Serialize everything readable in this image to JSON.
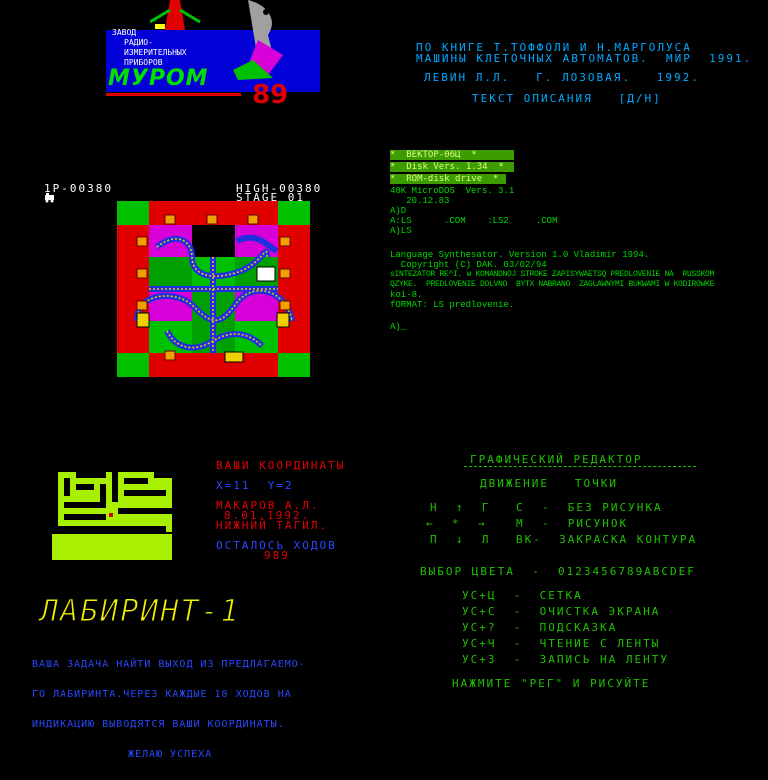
{
  "colors": {
    "red": "#e00000",
    "magenta": "#d800d8",
    "green": "#00c000",
    "yellow": "#e0e000",
    "cyan": "#00d8d8",
    "blue": "#2848ff",
    "lime": "#a8f000"
  },
  "panel1": {
    "company_lines": [
      "ЗАВОД",
      "РАДИО-",
      "ИЗМЕРИТЕЛЬНЫХ",
      "ПРИБОРОВ"
    ],
    "brand": "МУРОМ",
    "year": "89"
  },
  "panel2": {
    "lines": [
      "ПО КНИГЕ Т.ТОФФОЛИ И Н.МАРГОЛУСА",
      "МАШИНЫ КЛЕТОЧНЫХ АВТОМАТОВ.  МИР  1991.",
      "ЛЕВИН Л.Л.   Г. ЛОЗОВАЯ.   1992.",
      "ТЕКСТ ОПИСАНИЯ   [Д/Н]"
    ]
  },
  "panel3": {
    "score": "1P-00380",
    "high": "HIGH-00380",
    "stage": "STAGE 01",
    "lives_icon": "locomotive-icon"
  },
  "panel4": {
    "header_lines": [
      "*  ВЕКТОР-06Ц  *",
      "*  Disk Vers. 1.34  *",
      "*  ROM-disk drive  *"
    ],
    "body_lines": [
      "48K MicroDOS  Vers. 3.1",
      "   20.12.83",
      "A)D",
      "A:LS      .COM    :LS2     .COM",
      "A)LS",
      "",
      "Language Synthesator. Version 1.0 Vladimir 1994.",
      "  Copyright (C) DAK. 03/02/94",
      "sINTEZATOR RE^I. w KOMANDNOJ STROKE ZAPISYWAETSQ PREDLOVENIE NA  RUSSKOM",
      "QZYKE.  PREDLOVENIE DOLVNO  BYTX NABRANO  ZAGLAWNYMI BUKWAMI W KODIROWKE",
      "koi-8.",
      "fORMAT: LS predlovenie.",
      "",
      "A)_"
    ]
  },
  "panel5": {
    "coords_title": "ВАШИ КООРДИНАТЫ",
    "coords": "X=11  Y=2",
    "author": "МАКАРОВ А.Л.",
    "date": "8.01.1992.",
    "city": "НИЖНИЙ ТАГИЛ.",
    "moves_label": "ОСТАЛОСЬ ХОДОВ",
    "moves_value": "989",
    "title": "ЛАБИРИНТ-1",
    "desc_lines": [
      "ВАША ЗАДАЧА НАЙТИ ВЫХОД ИЗ ПРЕДЛАГАЕМО-",
      "ГО ЛАБИРИНТА.ЧЕРЕЗ КАЖДЫЕ 10 ХОДОВ НА",
      "ИНДИКАЦИЮ ВЫВОДЯТСЯ ВАШИ КООРДИНАТЫ.",
      "ЖЕЛАЮ УСПЕХА"
    ]
  },
  "panel6": {
    "title": "ГРАФИЧЕСКИЙ РЕДАКТОР",
    "move_label": "ДВИЖЕНИЕ   ТОЧКИ",
    "keys": [
      {
        "k": "Н  ↑  Г",
        "d": "С  -  БЕЗ РИСУНКА"
      },
      {
        "k": "←  *  →",
        "d": "М  -  РИСУНОК"
      },
      {
        "k": "П  ↓  Л",
        "d": "ВК-  ЗАКРАСКА КОНТУРА"
      }
    ],
    "colors_line": "ВЫБОР ЦВЕТА  -  0123456789ABCDEF",
    "menu": [
      "УС+Ц  -  СЕТКА",
      "УС+С  -  ОЧИСТКА ЭКРАНА",
      "УС+?  -  ПОДСКАЗКА",
      "УС+Ч  -  ЧТЕНИЕ С ЛЕНТЫ",
      "УС+З  -  ЗАПИСЬ НА ЛЕНТУ"
    ],
    "footer": "НАЖМИТЕ \"РЕГ\" И РИСУЙТЕ"
  }
}
